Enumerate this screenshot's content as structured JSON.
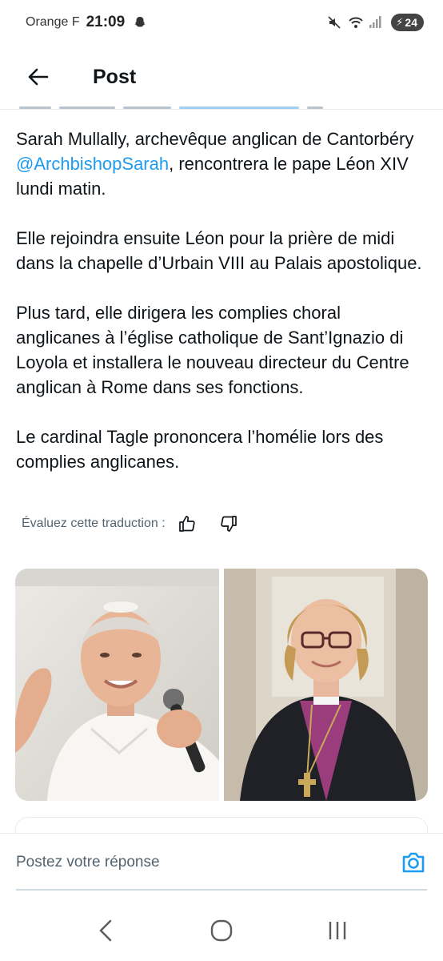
{
  "status_bar": {
    "carrier": "Orange F",
    "time": "21:09",
    "battery": "24",
    "icons": [
      "snapchat-ghost-icon",
      "mute-icon",
      "wifi-icon",
      "signal-icon",
      "battery-icon"
    ]
  },
  "header": {
    "title": "Post",
    "back_icon": "arrow-left-icon"
  },
  "post": {
    "paragraph1": {
      "before": "Sarah Mullally, archevêque anglican de Cantorbéry ",
      "mention": "@ArchbishopSarah",
      "after": ", rencontrera le pape Léon XIV lundi matin."
    },
    "paragraph2": "Elle rejoindra ensuite Léon pour la prière de midi dans la chapelle d’Urbain VIII au Palais apostolique.",
    "paragraph3": "Plus tard, elle dirigera les complies choral anglicanes à l’église catholique de Sant’Ignazio di Loyola et installera le nouveau directeur du Centre anglican à Rome dans ses fonctions.",
    "paragraph4": "Le cardinal Tagle prononcera l’homélie lors des complies anglicanes."
  },
  "translation": {
    "label": "Évaluez cette traduction :",
    "icons": [
      "thumbs-up-icon",
      "thumbs-down-icon"
    ]
  },
  "media": {
    "count": 2
  },
  "reply": {
    "placeholder": "Postez votre réponse",
    "camera_icon": "camera-icon"
  },
  "colors": {
    "accent": "#1d9bf0",
    "text": "#0f1419",
    "secondary": "#536471",
    "divider": "#e6ecf0"
  }
}
